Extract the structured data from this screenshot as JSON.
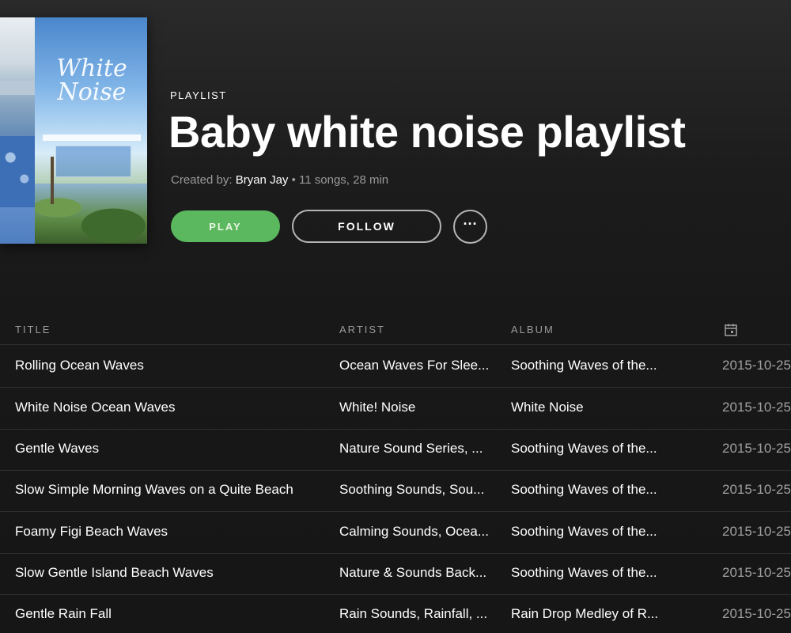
{
  "cover": {
    "title_line1": "White",
    "title_line2": "Noise",
    "icon": "album-cover-art"
  },
  "header": {
    "eyebrow": "PLAYLIST",
    "title": "Baby white noise playlist",
    "created_by_label": "Created by:",
    "creator": "Bryan Jay",
    "separator": " • ",
    "stats": "11 songs, 28 min"
  },
  "actions": {
    "play_label": "PLAY",
    "follow_label": "FOLLOW",
    "more_label": "···",
    "accent_color": "#5bb85e"
  },
  "table": {
    "columns": {
      "title": "TITLE",
      "artist": "ARTIST",
      "album": "ALBUM",
      "date_icon": "calendar-icon"
    },
    "rows": [
      {
        "title": "Rolling Ocean Waves",
        "artist": "Ocean Waves For Slee...",
        "album": "Soothing Waves of the...",
        "date": "2015-10-25"
      },
      {
        "title": "White Noise Ocean Waves",
        "artist": "White! Noise",
        "album": "White Noise",
        "date": "2015-10-25"
      },
      {
        "title": "Gentle Waves",
        "artist": "Nature Sound Series, ...",
        "album": "Soothing Waves of the...",
        "date": "2015-10-25"
      },
      {
        "title": "Slow Simple Morning Waves on a Quite Beach",
        "artist": "Soothing Sounds, Sou...",
        "album": "Soothing Waves of the...",
        "date": "2015-10-25"
      },
      {
        "title": "Foamy Figi Beach Waves",
        "artist": "Calming Sounds, Ocea...",
        "album": "Soothing Waves of the...",
        "date": "2015-10-25"
      },
      {
        "title": "Slow Gentle Island Beach Waves",
        "artist": "Nature & Sounds Back...",
        "album": "Soothing Waves of the...",
        "date": "2015-10-25"
      },
      {
        "title": "Gentle Rain Fall",
        "artist": "Rain Sounds, Rainfall, ...",
        "album": "Rain Drop Medley of R...",
        "date": "2015-10-25"
      }
    ]
  }
}
